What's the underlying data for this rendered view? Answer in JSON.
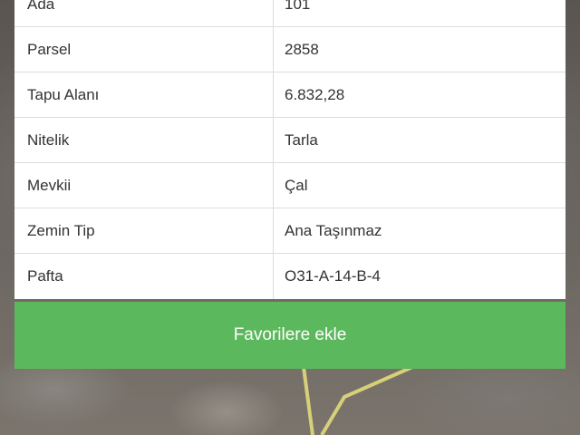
{
  "table": {
    "rows": [
      {
        "label": "Ada",
        "value": "101"
      },
      {
        "label": "Parsel",
        "value": "2858"
      },
      {
        "label": "Tapu Alanı",
        "value": "6.832,28"
      },
      {
        "label": "Nitelik",
        "value": "Tarla"
      },
      {
        "label": "Mevkii",
        "value": "Çal"
      },
      {
        "label": "Zemin Tip",
        "value": "Ana Taşınmaz"
      },
      {
        "label": "Pafta",
        "value": "O31-A-14-B-4"
      }
    ]
  },
  "actions": {
    "favorite_label": "Favorilere ekle"
  },
  "colors": {
    "button": "#5cb85c",
    "parcel_outline": "#d8cf7a"
  }
}
